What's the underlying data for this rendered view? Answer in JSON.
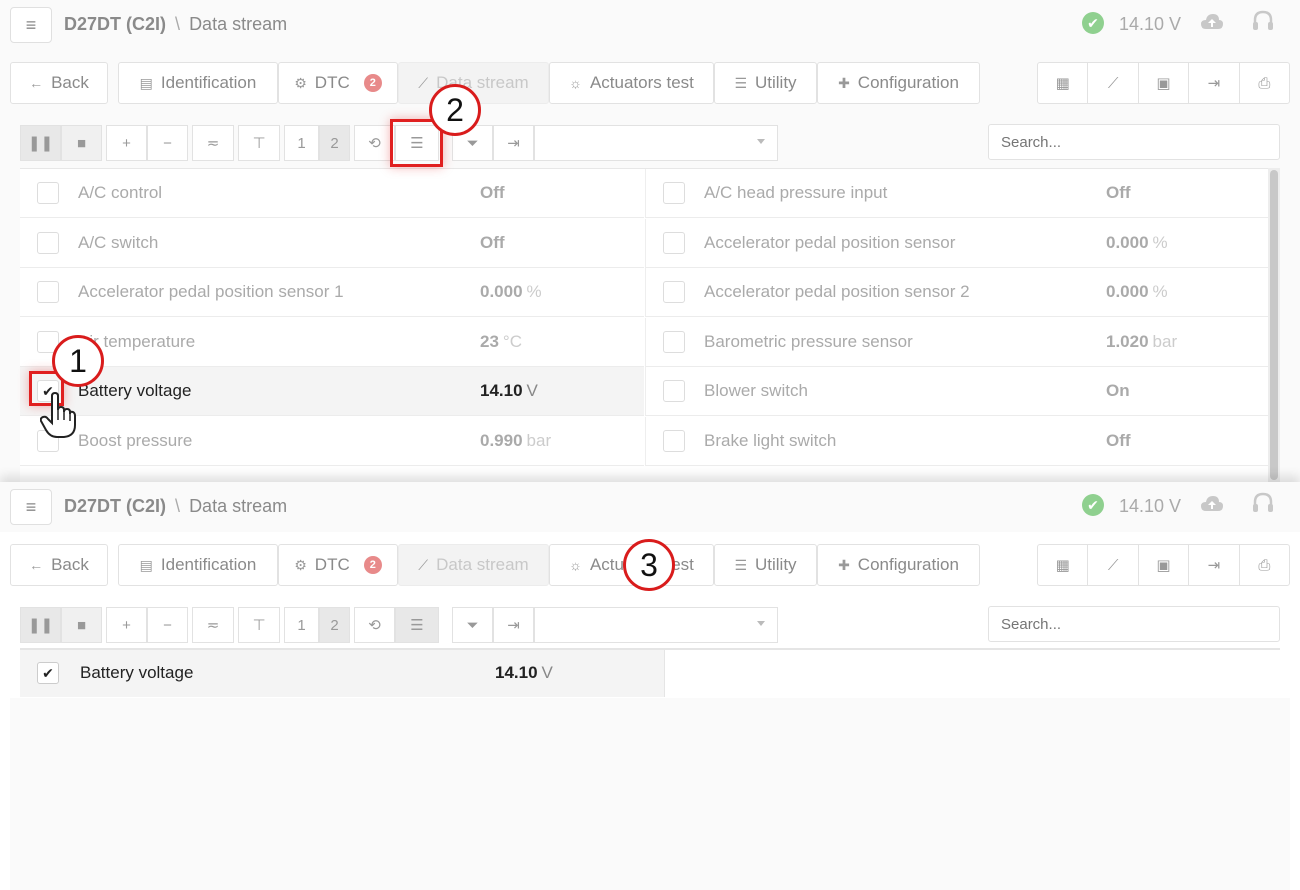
{
  "header": {
    "vehicle": "D27DT (C2I)",
    "separator": "\\",
    "section": "Data stream",
    "voltage": "14.10 V"
  },
  "nav": {
    "back": "Back",
    "identification": "Identification",
    "dtc": "DTC",
    "dtc_count": "2",
    "data_stream": "Data stream",
    "actuators": "Actuators test",
    "utility": "Utility",
    "configuration": "Configuration"
  },
  "toolbar": {
    "page1": "1",
    "page2": "2",
    "search_placeholder": "Search..."
  },
  "rows_left": [
    {
      "name": "A/C control",
      "value": "Off",
      "unit": ""
    },
    {
      "name": "A/C switch",
      "value": "Off",
      "unit": ""
    },
    {
      "name": "Accelerator pedal position sensor 1",
      "value": "0.000",
      "unit": "%"
    },
    {
      "name": "Air temperature",
      "value": "23",
      "unit": "°C"
    },
    {
      "name": "Battery voltage",
      "value": "14.10",
      "unit": "V"
    },
    {
      "name": "Boost pressure",
      "value": "0.990",
      "unit": "bar"
    }
  ],
  "rows_right": [
    {
      "name": "A/C head pressure input",
      "value": "Off",
      "unit": ""
    },
    {
      "name": "Accelerator pedal position sensor",
      "value": "0.000",
      "unit": "%"
    },
    {
      "name": "Accelerator pedal position sensor 2",
      "value": "0.000",
      "unit": "%"
    },
    {
      "name": "Barometric pressure sensor",
      "value": "1.020",
      "unit": "bar"
    },
    {
      "name": "Blower switch",
      "value": "On",
      "unit": ""
    },
    {
      "name": "Brake light switch",
      "value": "Off",
      "unit": ""
    }
  ],
  "filtered_row": {
    "name": "Battery voltage",
    "value": "14.10",
    "unit": "V"
  },
  "steps": {
    "one": "1",
    "two": "2",
    "three": "3"
  },
  "colors": {
    "accent_red": "#e02020",
    "ok_green": "#8fd08f",
    "badge": "#e88a8a"
  }
}
